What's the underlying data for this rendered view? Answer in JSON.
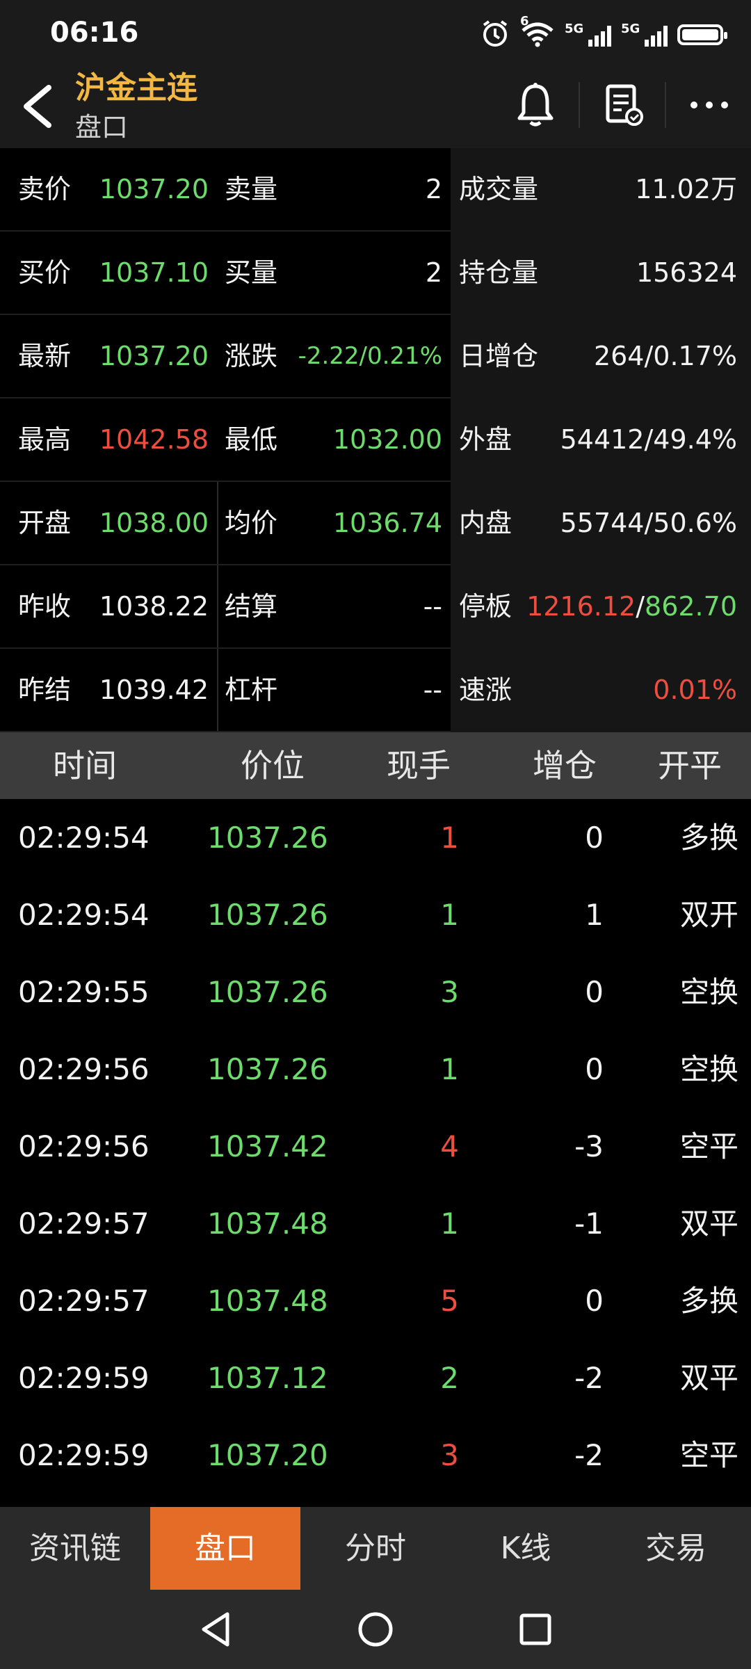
{
  "status": {
    "time": "06:16",
    "sig1": "5G",
    "sig2": "5G",
    "wifi_badge": "6"
  },
  "header": {
    "title": "沪金主连",
    "subtitle": "盘口"
  },
  "quote": {
    "sell_price_label": "卖价",
    "sell_price": "1037.20",
    "sell_vol_label": "卖量",
    "sell_vol": "2",
    "volume_label": "成交量",
    "volume": "11.02万",
    "buy_price_label": "买价",
    "buy_price": "1037.10",
    "buy_vol_label": "买量",
    "buy_vol": "2",
    "open_interest_label": "持仓量",
    "open_interest": "156324",
    "last_label": "最新",
    "last": "1037.20",
    "change_label": "涨跌",
    "change": "-2.22/0.21%",
    "daily_oi_label": "日增仓",
    "daily_oi": "264/0.17%",
    "high_label": "最高",
    "high": "1042.58",
    "low_label": "最低",
    "low": "1032.00",
    "outer_label": "外盘",
    "outer": "54412/49.4%",
    "open_label": "开盘",
    "open": "1038.00",
    "avg_label": "均价",
    "avg": "1036.74",
    "inner_label": "内盘",
    "inner": "55744/50.6%",
    "prev_close_label": "昨收",
    "prev_close": "1038.22",
    "settle_label": "结算",
    "settle": "--",
    "limit_label": "停板",
    "limit_up": "1216.12",
    "limit_sep": "/",
    "limit_down": "862.70",
    "prev_settle_label": "昨结",
    "prev_settle": "1039.42",
    "leverage_label": "杠杆",
    "leverage": "--",
    "speed_label": "速涨",
    "speed": "0.01%"
  },
  "trades": {
    "headers": [
      "时间",
      "价位",
      "现手",
      "增仓",
      "开平"
    ],
    "rows": [
      {
        "time": "02:29:54",
        "price": "1037.26",
        "vol": "1",
        "vol_color": "red",
        "oi": "0",
        "type": "多换"
      },
      {
        "time": "02:29:54",
        "price": "1037.26",
        "vol": "1",
        "vol_color": "green",
        "oi": "1",
        "type": "双开"
      },
      {
        "time": "02:29:55",
        "price": "1037.26",
        "vol": "3",
        "vol_color": "green",
        "oi": "0",
        "type": "空换"
      },
      {
        "time": "02:29:56",
        "price": "1037.26",
        "vol": "1",
        "vol_color": "green",
        "oi": "0",
        "type": "空换"
      },
      {
        "time": "02:29:56",
        "price": "1037.42",
        "vol": "4",
        "vol_color": "red",
        "oi": "-3",
        "type": "空平"
      },
      {
        "time": "02:29:57",
        "price": "1037.48",
        "vol": "1",
        "vol_color": "green",
        "oi": "-1",
        "type": "双平"
      },
      {
        "time": "02:29:57",
        "price": "1037.48",
        "vol": "5",
        "vol_color": "red",
        "oi": "0",
        "type": "多换"
      },
      {
        "time": "02:29:59",
        "price": "1037.12",
        "vol": "2",
        "vol_color": "green",
        "oi": "-2",
        "type": "双平"
      },
      {
        "time": "02:29:59",
        "price": "1037.20",
        "vol": "3",
        "vol_color": "red",
        "oi": "-2",
        "type": "空平"
      }
    ]
  },
  "tabs": [
    {
      "label": "资讯链"
    },
    {
      "label": "盘口"
    },
    {
      "label": "分时"
    },
    {
      "label": "K线"
    },
    {
      "label": "交易"
    }
  ],
  "colors": {
    "accent": "#e46c26",
    "title": "#f3b743",
    "up": "#ee4e40",
    "down": "#6ddc6d"
  },
  "icons": [
    "alarm-icon",
    "wifi-icon",
    "signal-icon",
    "battery-icon",
    "back-icon",
    "bell-icon",
    "note-icon",
    "more-icon",
    "nav-back-icon",
    "nav-home-icon",
    "nav-recent-icon"
  ]
}
